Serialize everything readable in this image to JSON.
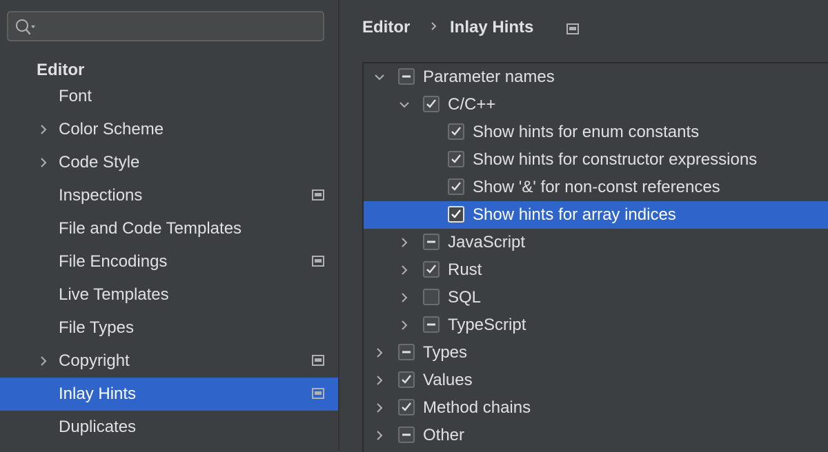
{
  "search": {
    "value": "",
    "placeholder": ""
  },
  "sidebar": {
    "group_title": "Editor",
    "items": [
      {
        "label": "Font",
        "expandable": false,
        "project": false
      },
      {
        "label": "Color Scheme",
        "expandable": true,
        "project": false
      },
      {
        "label": "Code Style",
        "expandable": true,
        "project": false
      },
      {
        "label": "Inspections",
        "expandable": false,
        "project": true
      },
      {
        "label": "File and Code Templates",
        "expandable": false,
        "project": false
      },
      {
        "label": "File Encodings",
        "expandable": false,
        "project": true
      },
      {
        "label": "Live Templates",
        "expandable": false,
        "project": false
      },
      {
        "label": "File Types",
        "expandable": false,
        "project": false
      },
      {
        "label": "Copyright",
        "expandable": true,
        "project": true
      },
      {
        "label": "Inlay Hints",
        "expandable": false,
        "project": true,
        "selected": true
      },
      {
        "label": "Duplicates",
        "expandable": false,
        "project": false
      }
    ]
  },
  "breadcrumb": {
    "parent": "Editor",
    "current": "Inlay Hints"
  },
  "tree": {
    "rows": [
      {
        "label": "Parameter names",
        "level": 0,
        "chevron": "down",
        "state": "mixed"
      },
      {
        "label": "C/C++",
        "level": 1,
        "chevron": "down",
        "state": "checked"
      },
      {
        "label": "Show hints for enum constants",
        "level": 2,
        "chevron": "none",
        "state": "checked"
      },
      {
        "label": "Show hints for constructor expressions",
        "level": 2,
        "chevron": "none",
        "state": "checked"
      },
      {
        "label": "Show '&' for non-const references",
        "level": 2,
        "chevron": "none",
        "state": "checked"
      },
      {
        "label": "Show hints for array indices",
        "level": 2,
        "chevron": "none",
        "state": "checked",
        "selected": true
      },
      {
        "label": "JavaScript",
        "level": 1,
        "chevron": "right",
        "state": "mixed"
      },
      {
        "label": "Rust",
        "level": 1,
        "chevron": "right",
        "state": "checked"
      },
      {
        "label": "SQL",
        "level": 1,
        "chevron": "right",
        "state": "unchecked"
      },
      {
        "label": "TypeScript",
        "level": 1,
        "chevron": "right",
        "state": "mixed"
      },
      {
        "label": "Types",
        "level": 0,
        "chevron": "right",
        "state": "mixed"
      },
      {
        "label": "Values",
        "level": 0,
        "chevron": "right",
        "state": "checked"
      },
      {
        "label": "Method chains",
        "level": 0,
        "chevron": "right",
        "state": "checked"
      },
      {
        "label": "Other",
        "level": 0,
        "chevron": "right",
        "state": "mixed"
      }
    ]
  },
  "colors": {
    "background": "#3c3f41",
    "selection": "#2f65ca",
    "text": "#dfe1e5",
    "icon": "#afb1b3"
  },
  "icons": {
    "search": "search-icon",
    "chevron_right": "chevron-right-icon",
    "chevron_down": "chevron-down-icon",
    "project_scope": "project-scope-icon",
    "checkbox_checked": "checkmark-icon",
    "checkbox_mixed": "indeterminate-icon"
  }
}
